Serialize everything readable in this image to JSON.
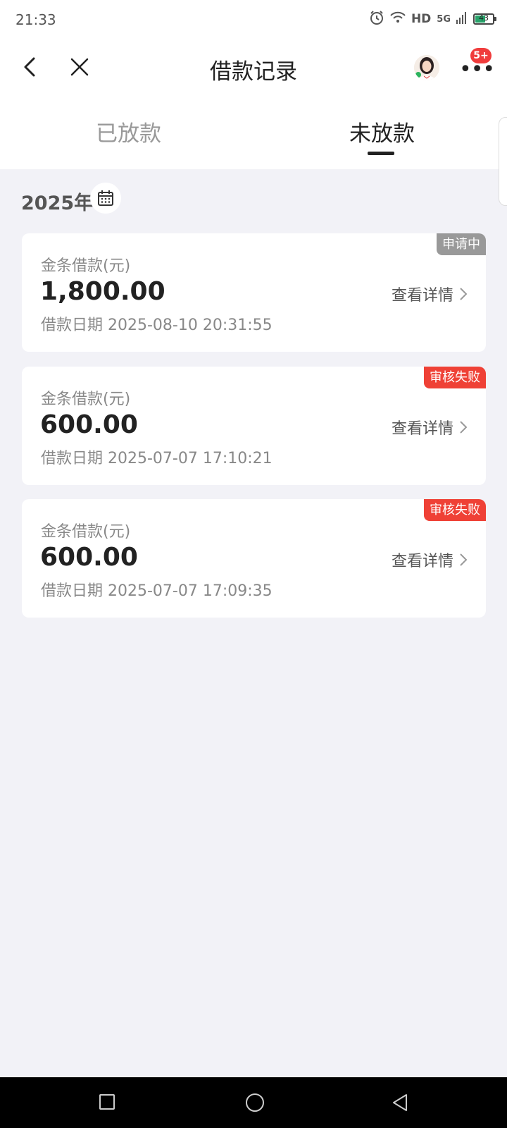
{
  "status_bar": {
    "time": "21:33",
    "hd": "HD",
    "network": "5G",
    "battery": "43"
  },
  "header": {
    "title": "借款记录",
    "more_badge": "5+"
  },
  "tabs": [
    {
      "label": "已放款",
      "active": false
    },
    {
      "label": "未放款",
      "active": true
    }
  ],
  "year": {
    "label": "2025年"
  },
  "records": [
    {
      "label": "金条借款(元)",
      "amount": "1,800.00",
      "date": "借款日期 2025-08-10 20:31:55",
      "detail": "查看详情",
      "status": "申请中",
      "status_color": "#999999"
    },
    {
      "label": "金条借款(元)",
      "amount": "600.00",
      "date": "借款日期 2025-07-07 17:10:21",
      "detail": "查看详情",
      "status": "审核失败",
      "status_color": "#ef4136"
    },
    {
      "label": "金条借款(元)",
      "amount": "600.00",
      "date": "借款日期 2025-07-07 17:09:35",
      "detail": "查看详情",
      "status": "审核失败",
      "status_color": "#ef4136"
    }
  ]
}
